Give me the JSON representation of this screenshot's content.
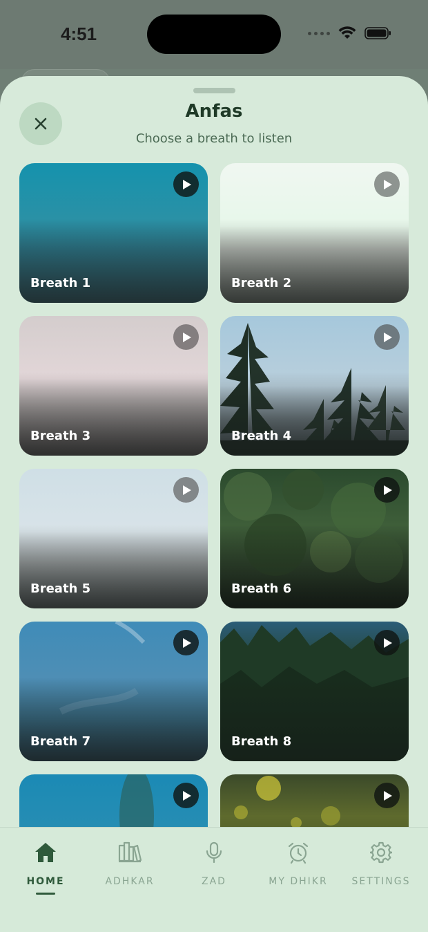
{
  "status_bar": {
    "time": "4:51"
  },
  "sheet": {
    "title": "Anfas",
    "subtitle": "Choose a breath to listen"
  },
  "cards": [
    {
      "label": "Breath 1"
    },
    {
      "label": "Breath 2"
    },
    {
      "label": "Breath 3"
    },
    {
      "label": "Breath 4"
    },
    {
      "label": "Breath 5"
    },
    {
      "label": "Breath 6"
    },
    {
      "label": "Breath 7"
    },
    {
      "label": "Breath 8"
    },
    {
      "label": ""
    },
    {
      "label": ""
    }
  ],
  "tab_bar": {
    "tabs": [
      {
        "label": "HOME",
        "icon": "home-icon",
        "active": true
      },
      {
        "label": "ADHKAR",
        "icon": "books-icon",
        "active": false
      },
      {
        "label": "ZAD",
        "icon": "microphone-icon",
        "active": false
      },
      {
        "label": "MY DHIKR",
        "icon": "alarm-clock-icon",
        "active": false
      },
      {
        "label": "SETTINGS",
        "icon": "gear-icon",
        "active": false
      }
    ]
  },
  "colors": {
    "sheet_background": "#d7eada",
    "accent": "#2f5a3b",
    "inactive_tab": "#8aa592"
  }
}
